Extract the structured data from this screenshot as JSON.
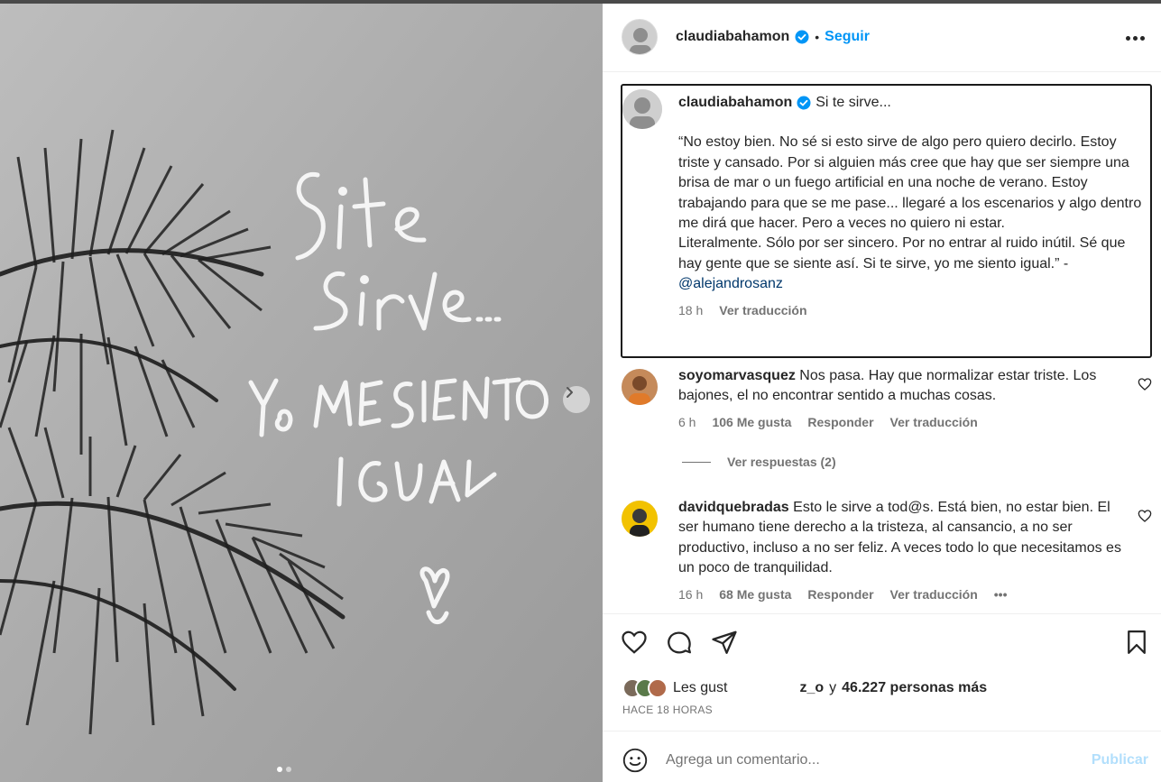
{
  "post": {
    "username": "claudiabahamon",
    "separator": "•",
    "follow_label": "Seguir",
    "more_icon": "more-horizontal-icon",
    "verified_icon": "verified-badge-icon",
    "verified_color": "#0095f6"
  },
  "media": {
    "handwritten_text": [
      "Si te",
      "sirve...",
      "Yo ME SIENTO",
      "IGUAL"
    ],
    "next_icon": "chevron-right-icon",
    "slide_count": 2,
    "current_slide": 1
  },
  "caption": {
    "username": "claudiabahamon",
    "title": "Si te sirve...",
    "lines": [
      "“No estoy bien. No sé si esto sirve de algo pero quiero decirlo. Estoy triste y cansado. Por si alguien más cree que hay que ser siempre una brisa de mar o un fuego artificial en una noche de verano. Estoy trabajando para que se me pase... llegaré a los escenarios y algo dentro me dirá que hacer. Pero a veces no quiero ni estar.",
      "Literalmente. Sólo por ser sincero. Por no entrar al ruido inútil. Sé que hay gente que se siente así. Si te sirve, yo me siento igual.” -"
    ],
    "mention": "@alejandrosanz",
    "time": "18 h",
    "translate": "Ver traducción"
  },
  "comments": [
    {
      "username": "soyomarvasquez",
      "text": "Nos pasa. Hay que normalizar estar triste. Los bajones, el no encontrar sentido a muchas cosas.",
      "time": "6 h",
      "likes": "106 Me gusta",
      "reply": "Responder",
      "translate": "Ver traducción",
      "view_replies": "Ver respuestas (2)"
    },
    {
      "username": "davidquebradas",
      "text": "Esto le sirve a tod@s. Está bien, no estar bien. El ser humano tiene derecho a la tristeza, al cansancio, a no ser productivo, incluso a no ser feliz. A veces todo lo que necesitamos es un poco de tranquilidad.",
      "time": "16 h",
      "likes": "68 Me gusta",
      "reply": "Responder",
      "translate": "Ver traducción",
      "more": "•••"
    }
  ],
  "actions": {
    "like_icon": "heart-icon",
    "comment_icon": "comment-icon",
    "share_icon": "send-icon",
    "save_icon": "bookmark-icon"
  },
  "likes": {
    "prefix": "Les gust",
    "liker": "z_o",
    "connector": "y",
    "count": "46.227 personas más"
  },
  "posted_ago": "HACE 18 HORAS",
  "add_comment": {
    "placeholder": "Agrega un comentario...",
    "publish_label": "Publicar",
    "emoji_icon": "emoji-icon"
  }
}
